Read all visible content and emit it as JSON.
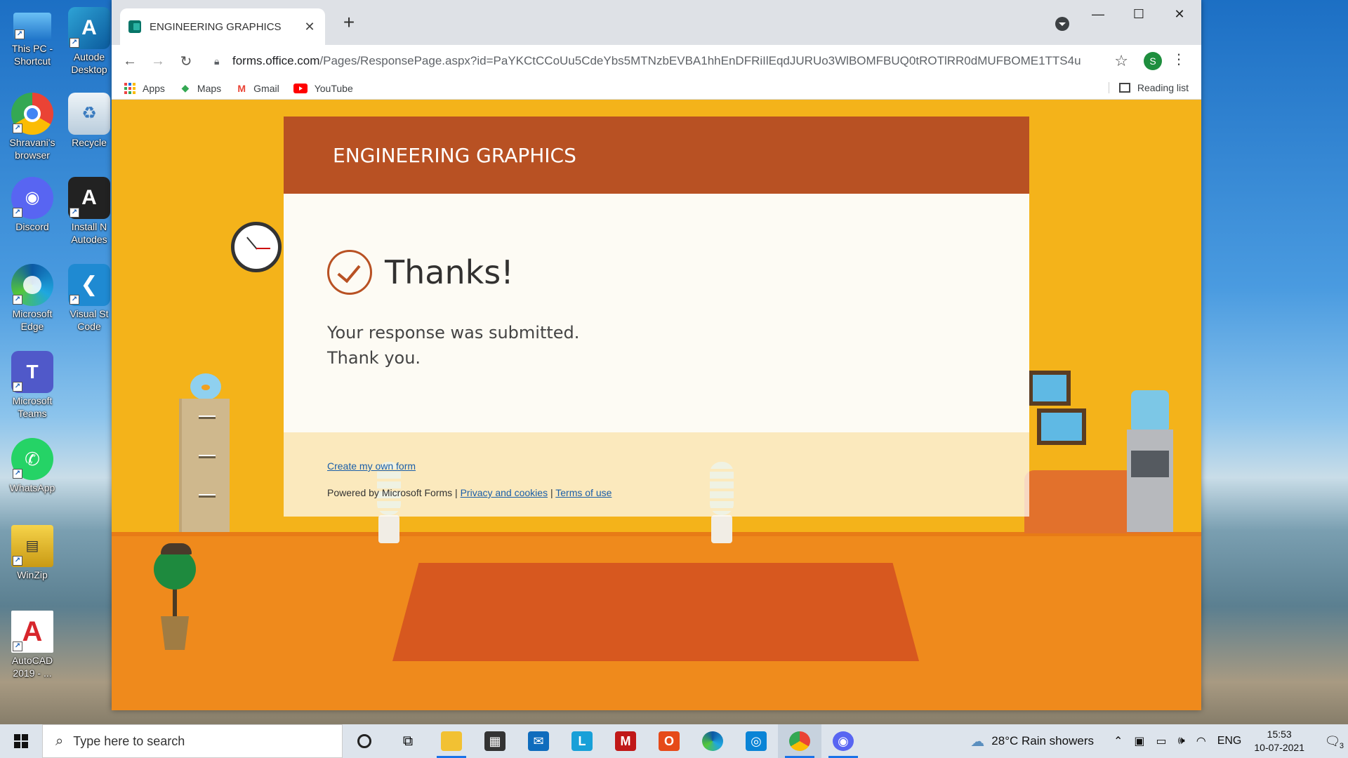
{
  "desktop": {
    "icons": [
      {
        "label": "This PC - Shortcut",
        "icon": "computer-icon"
      },
      {
        "label": "Autode Desktop",
        "icon": "autodesk-icon"
      },
      {
        "label": "Shravani's browser",
        "icon": "chrome-icon"
      },
      {
        "label": "Recycle",
        "icon": "recycle-bin-icon"
      },
      {
        "label": "Discord",
        "icon": "discord-icon"
      },
      {
        "label": "Install N Autodes",
        "icon": "autodesk-install-icon"
      },
      {
        "label": "Microsoft Edge",
        "icon": "edge-icon"
      },
      {
        "label": "Visual St Code",
        "icon": "vscode-icon"
      },
      {
        "label": "Microsoft Teams",
        "icon": "teams-icon"
      },
      {
        "label": "WhatsApp",
        "icon": "whatsapp-icon"
      },
      {
        "label": "WinZip",
        "icon": "winzip-icon"
      },
      {
        "label": "AutoCAD 2019 - ...",
        "icon": "autocad-icon"
      }
    ]
  },
  "browser": {
    "tab_title": "ENGINEERING GRAPHICS",
    "tab_close": "✕",
    "new_tab": "+",
    "url_host": "forms.office.com",
    "url_path": "/Pages/ResponsePage.aspx?id=PaYKCtCCoUu5CdeYbs5MTNzbEVBA1hhEnDFRiIlEqdJURUo3WlBOMFBUQ0tROTlRR0dMUFBOME1TTS4u",
    "profile_initial": "S",
    "bookmarks": [
      {
        "label": "Apps",
        "icon": "apps-grid-icon"
      },
      {
        "label": "Maps",
        "icon": "maps-icon"
      },
      {
        "label": "Gmail",
        "icon": "gmail-icon"
      },
      {
        "label": "YouTube",
        "icon": "youtube-icon"
      }
    ],
    "reading_list": "Reading list"
  },
  "form": {
    "header_title": "ENGINEERING GRAPHICS",
    "thanks": "Thanks!",
    "submitted_line1": "Your response was submitted.",
    "submitted_line2": "Thank you.",
    "create_link": "Create my own form",
    "powered_by": "Powered by Microsoft Forms |",
    "privacy_link": "Privacy and cookies",
    "sep": "|",
    "terms_link": "Terms of use"
  },
  "taskbar": {
    "search_placeholder": "Type here to search",
    "weather": "28°C  Rain showers",
    "language": "ENG",
    "time": "15:53",
    "date": "10-07-2021",
    "notification_count": "3"
  },
  "colors": {
    "form_accent": "#b85123",
    "page_background": "#f4b31a",
    "floor": "#ef8a1c"
  }
}
